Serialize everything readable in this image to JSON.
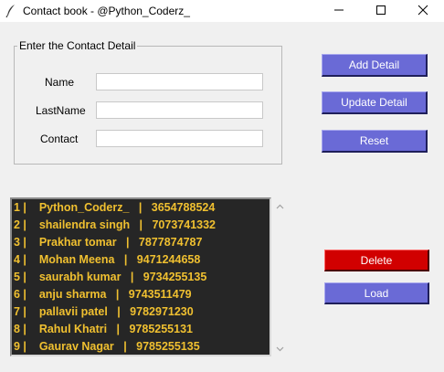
{
  "window": {
    "title": "Contact book - @Python_Coderz_"
  },
  "form": {
    "legend": "Enter the Contact Detail",
    "fields": [
      {
        "label": "Name",
        "value": ""
      },
      {
        "label": "LastName",
        "value": ""
      },
      {
        "label": "Contact",
        "value": ""
      }
    ]
  },
  "buttons": {
    "add": "Add Detail",
    "update": "Update Detail",
    "reset": "Reset",
    "delete": "Delete",
    "load": "Load"
  },
  "contacts": [
    "1 |    Python_Coderz_   |   3654788524",
    "2 |    shailendra singh   |   7073741332",
    "3 |    Prakhar tomar   |   7877874787",
    "4 |    Mohan Meena   |   9471244658",
    "5 |    saurabh kumar   |   9734255135",
    "6 |    anju sharma   |   9743511479",
    "7 |    pallavii patel   |   9782971230",
    "8 |    Rahul Khatri   |   9785255131",
    "9 |    Gaurav Nagar   |   9785255135"
  ],
  "colors": {
    "button_primary": "#6a6ad6",
    "button_danger": "#d10000",
    "listbox_bg": "#262626",
    "listbox_text": "#f0c030"
  },
  "icons": {
    "app": "feather-icon",
    "minimize": "minimize-icon",
    "maximize": "maximize-icon",
    "close": "close-icon",
    "scroll_up": "scroll-up-arrow-icon",
    "scroll_down": "scroll-down-arrow-icon"
  }
}
